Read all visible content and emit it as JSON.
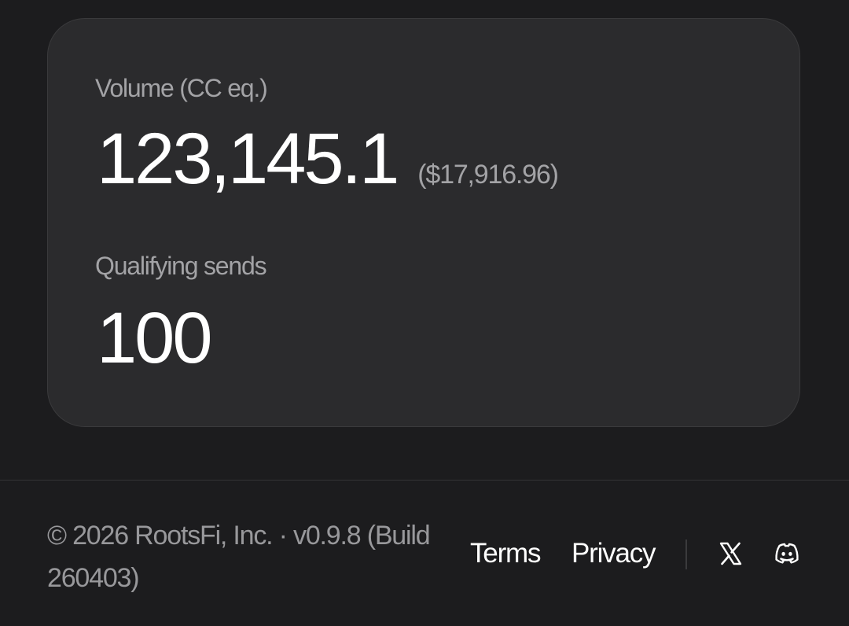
{
  "stats": {
    "volume_label": "Volume (CC eq.)",
    "volume_value": "123,145.1",
    "volume_usd": "($17,916.96)",
    "sends_label": "Qualifying sends",
    "sends_value": "100"
  },
  "footer": {
    "copyright": "© 2026 RootsFi, Inc. · v0.9.8 (Build 260403)",
    "links": [
      {
        "label": "Terms"
      },
      {
        "label": "Privacy"
      }
    ],
    "social_icons": [
      "x-icon",
      "discord-icon"
    ]
  },
  "colors": {
    "background": "#1c1c1e",
    "card": "#2b2b2d",
    "muted_text": "#a3a3a6",
    "primary_text": "#ffffff"
  }
}
